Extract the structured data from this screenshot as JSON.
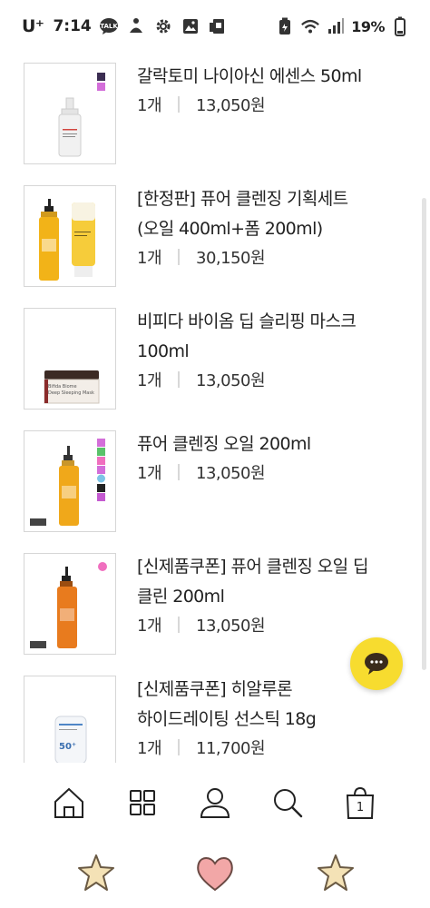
{
  "status_bar": {
    "carrier": "U⁺",
    "time": "7:14",
    "battery": "19%",
    "icons": [
      "talk-icon",
      "wellness-icon",
      "settings-icon",
      "gallery-icon",
      "sim-icon",
      "battery-saver-icon",
      "wifi-icon",
      "signal-icon",
      "battery-icon"
    ]
  },
  "products": [
    {
      "name_line1": "갈락토미 나이아신 에센스 50ml",
      "name_line2": "",
      "qty": "1개",
      "price": "13,050원"
    },
    {
      "name_line1": "[한정판] 퓨어 클렌징 기획세트",
      "name_line2": "(오일 400ml+폼 200ml)",
      "qty": "1개",
      "price": "30,150원"
    },
    {
      "name_line1": "비피다 바이옴 딥 슬리핑 마스크",
      "name_line2": "100ml",
      "qty": "1개",
      "price": "13,050원"
    },
    {
      "name_line1": "퓨어 클렌징 오일 200ml",
      "name_line2": "",
      "qty": "1개",
      "price": "13,050원"
    },
    {
      "name_line1": "[신제품쿠폰] 퓨어 클렌징 오일 딥",
      "name_line2": "클린 200ml",
      "qty": "1개",
      "price": "13,050원"
    },
    {
      "name_line1": "[신제품쿠폰] 히알루론",
      "name_line2": "하이드레이팅 선스틱 18g",
      "qty": "1개",
      "price": "11,700원"
    }
  ],
  "thumb_text": {
    "sleeping_mask": "Bifida Biome\nDeep Sleeping Mask",
    "sunstick_spf": "50⁺"
  },
  "chat_button": {
    "glyph": "···"
  },
  "bottom_nav": {
    "items": [
      "home-icon",
      "category-icon",
      "my-page-icon",
      "search-icon",
      "cart-icon"
    ],
    "cart_count": "1"
  },
  "colors": {
    "accent_yellow": "#f7dc2f",
    "heart_pink": "#f2a7a7",
    "star_beige": "#f4e2b6"
  }
}
